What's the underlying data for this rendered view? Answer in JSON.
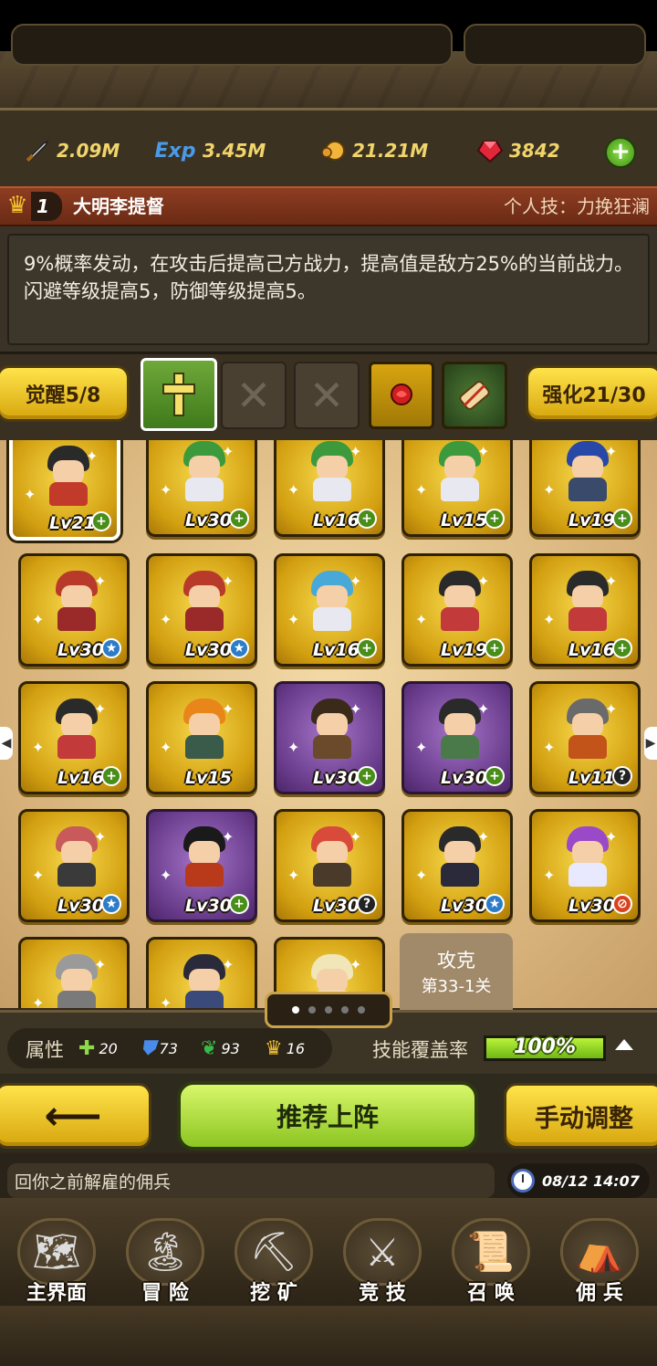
{
  "resources": {
    "attack": "2.09M",
    "exp": "3.45M",
    "gold": "21.21M",
    "gems": "3842"
  },
  "hero": {
    "rank": "1",
    "name": "大明李提督",
    "skill": "个人技：力挽狂澜",
    "description": "9%概率发动，在攻击后提高己方战力，提高值是敌方25%的当前战力。闪避等级提高5，防御等级提高5。"
  },
  "awakening": {
    "label": "觉醒5/8",
    "enhance_label": "强化21/30"
  },
  "grid": {
    "cards": [
      {
        "level": "Lv21",
        "badge": "plus",
        "frame": "gold",
        "hair": "#2a2a2a",
        "body": "#c23a2a"
      },
      {
        "level": "Lv30",
        "badge": "plus",
        "frame": "gold",
        "hair": "#3c9a3c",
        "body": "#e8e8f0"
      },
      {
        "level": "Lv16",
        "badge": "plus",
        "frame": "gold",
        "hair": "#3c9a3c",
        "body": "#e8e8f0"
      },
      {
        "level": "Lv15",
        "badge": "plus",
        "frame": "gold",
        "hair": "#3c9a3c",
        "body": "#e8e8f0"
      },
      {
        "level": "Lv19",
        "badge": "plus",
        "frame": "gold",
        "hair": "#2848a8",
        "body": "#3a4a6a"
      },
      {
        "level": "Lv30",
        "badge": "star",
        "frame": "gold",
        "hair": "#b83a2a",
        "body": "#9a2a2a"
      },
      {
        "level": "Lv30",
        "badge": "star",
        "frame": "gold",
        "hair": "#b83a2a",
        "body": "#9a2a2a"
      },
      {
        "level": "Lv16",
        "badge": "plus",
        "frame": "gold",
        "hair": "#48a8d8",
        "body": "#e8e8f0"
      },
      {
        "level": "Lv19",
        "badge": "plus",
        "frame": "gold",
        "hair": "#2a2a2a",
        "body": "#c23a3a"
      },
      {
        "level": "Lv16",
        "badge": "plus",
        "frame": "gold",
        "hair": "#2a2a2a",
        "body": "#c23a3a"
      },
      {
        "level": "Lv16",
        "badge": "plus",
        "frame": "gold",
        "hair": "#2a2a2a",
        "body": "#c23a3a"
      },
      {
        "level": "Lv15",
        "badge": "none",
        "frame": "gold",
        "hair": "#e8861a",
        "body": "#3a5a4a"
      },
      {
        "level": "Lv30",
        "badge": "plus",
        "frame": "purple",
        "hair": "#3a2a1a",
        "body": "#6a4a2a"
      },
      {
        "level": "Lv30",
        "badge": "plus",
        "frame": "purple",
        "hair": "#2a2a2a",
        "body": "#4a7a4a"
      },
      {
        "level": "Lv11",
        "badge": "q",
        "frame": "gold",
        "hair": "#6a6a6a",
        "body": "#c2541a"
      },
      {
        "level": "Lv30",
        "badge": "star",
        "frame": "gold",
        "hair": "#c85a5a",
        "body": "#3a3a3a"
      },
      {
        "level": "Lv30",
        "badge": "plus",
        "frame": "purple",
        "hair": "#1a1a1a",
        "body": "#b83a1a"
      },
      {
        "level": "Lv30",
        "badge": "q",
        "frame": "gold",
        "hair": "#d84a3a",
        "body": "#4a3a2a"
      },
      {
        "level": "Lv30",
        "badge": "star",
        "frame": "gold",
        "hair": "#2a2a2a",
        "body": "#2a2a3a"
      },
      {
        "level": "Lv30",
        "badge": "no",
        "frame": "gold",
        "hair": "#9a4ac8",
        "body": "#e8e8ff"
      },
      {
        "level": "",
        "badge": "none",
        "frame": "gold",
        "hair": "#9a9a9a",
        "body": "#7a7a7a"
      },
      {
        "level": "",
        "badge": "none",
        "frame": "gold",
        "hair": "#2a2a3a",
        "body": "#3a4a7a"
      },
      {
        "level": "",
        "badge": "none",
        "frame": "gold",
        "hair": "#f0e6b8",
        "body": "#f0e6b8"
      }
    ],
    "attack_tile": {
      "title": "攻克",
      "sub": "第33-1关"
    }
  },
  "attributes": {
    "label": "属性",
    "green": "20",
    "shield": "73",
    "wing": "93",
    "crown": "16"
  },
  "coverage": {
    "label": "技能覆盖率",
    "value": "100%",
    "fraction": 1.0
  },
  "actions": {
    "recommend": "推荐上阵",
    "manual": "手动调整"
  },
  "ticker": {
    "text": "回你之前解雇的佣兵",
    "time": "08/12 14:07"
  },
  "nav": [
    {
      "label": "主界面",
      "icon": "map-scroll-icon"
    },
    {
      "label": "冒 险",
      "icon": "island-icon"
    },
    {
      "label": "挖 矿",
      "icon": "pickaxe-icon"
    },
    {
      "label": "竞 技",
      "icon": "crossed-swords-icon"
    },
    {
      "label": "召 唤",
      "icon": "summon-scroll-icon"
    },
    {
      "label": "佣 兵",
      "icon": "tent-icon"
    }
  ]
}
